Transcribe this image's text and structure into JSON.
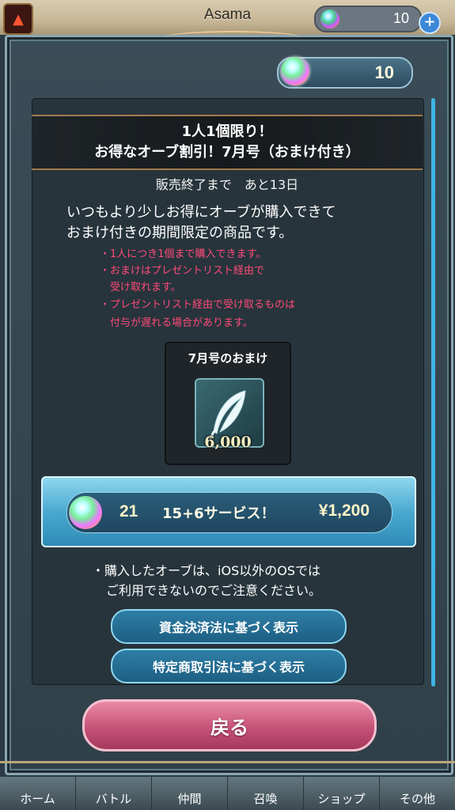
{
  "topbar": {
    "player_name": "Asama",
    "orb_count": "10"
  },
  "gems": {
    "count": "10"
  },
  "offer": {
    "title_line1": "1人1個限り！",
    "title_line2": "お得なオーブ割引！7月号（おまけ付き）",
    "deadline": "販売終了まで　あと13日",
    "desc_line1": "いつもより少しお得にオーブが購入できて",
    "desc_line2": "おまけ付きの期間限定の商品です。",
    "notes": [
      "・1人につき1個まで購入できます。",
      "・おまけはプレゼントリスト経由で",
      "　受け取れます。",
      "・プレゼントリスト経由で受け取るものは",
      "　付与が遅れる場合があります。"
    ]
  },
  "bonus": {
    "title": "7月号のおまけ",
    "amount": "6,000",
    "icon": "feather-icon"
  },
  "purchase": {
    "count": "21",
    "label": "15+6サービス！",
    "price": "¥1,200"
  },
  "ios_note": {
    "line1": "・購入したオーブは、iOS以外のOSでは",
    "line2": "ご利用できないのでご注意ください。"
  },
  "buttons": {
    "funds_settlement": "資金決済法に基づく表示",
    "commercial_transactions": "特定商取引法に基づく表示",
    "back": "戻る"
  },
  "nav": [
    "ホーム",
    "バトル",
    "仲間",
    "召喚",
    "ショップ",
    "その他"
  ],
  "colors": {
    "note_text": "#ff4a7a",
    "accent_blue": "#3fb4e4",
    "back_button": "#c34e74"
  }
}
